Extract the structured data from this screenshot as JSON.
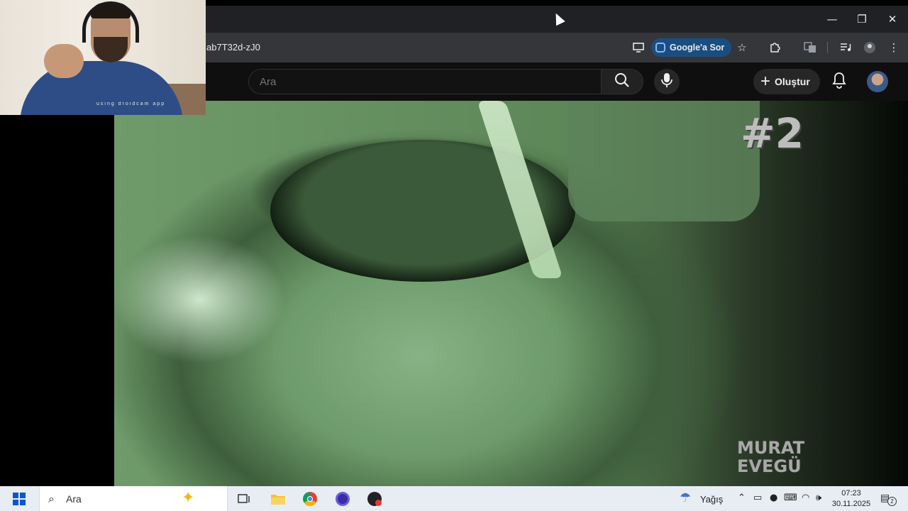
{
  "browser": {
    "url_fragment": "ab7T32d-zJ0",
    "ask_button_label": "Google'a Sor",
    "window_controls": {
      "minimize": "—",
      "maximize": "❐",
      "close": "✕"
    }
  },
  "youtube": {
    "search_placeholder": "Ara",
    "create_label": "Oluştur",
    "create_plus": "+"
  },
  "video": {
    "overlay_number": "#2",
    "watermark_line1": "MURAT",
    "watermark_line2": "EVEGÜ"
  },
  "webcam": {
    "watermark": "using droidcam app"
  },
  "taskbar": {
    "search_label": "Ara",
    "weather_label": "Yağış",
    "time": "07:23",
    "date": "30.11.2025",
    "notification_count": "2"
  },
  "icons": {
    "search": "search-icon",
    "mic": "mic-icon",
    "bell": "bell-icon",
    "star": "star-icon",
    "extensions": "puzzle-icon",
    "translate": "translate-icon",
    "menu": "kebab-menu-icon"
  }
}
